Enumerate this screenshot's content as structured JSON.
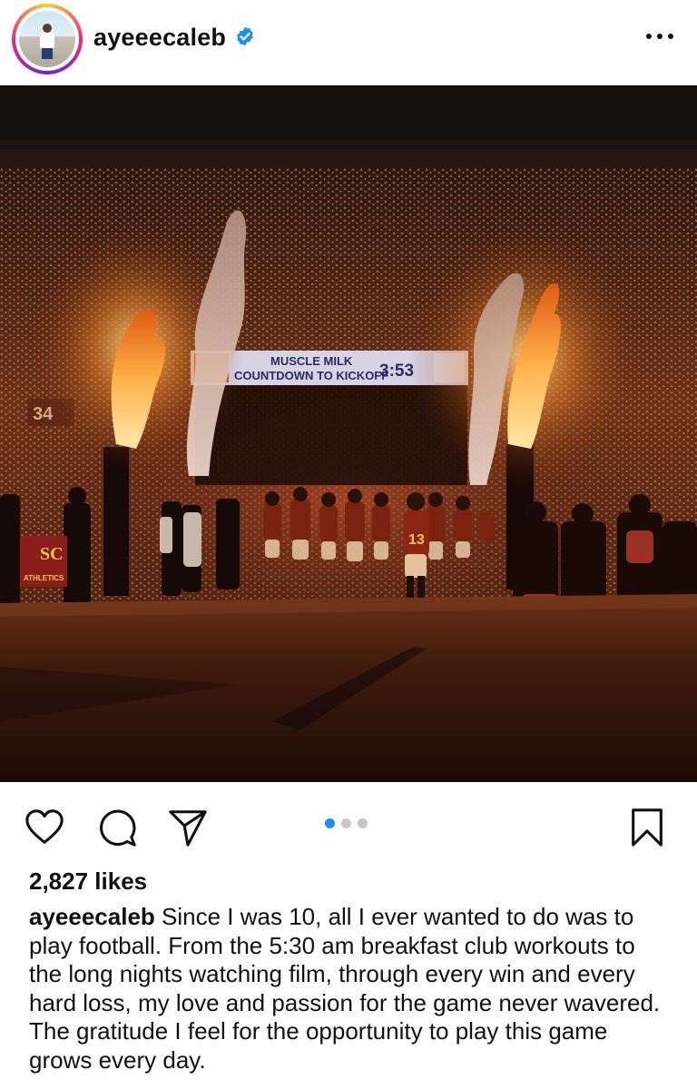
{
  "post": {
    "username": "ayeeecaleb",
    "verified": true,
    "likes": "2,827 likes",
    "caption_user": "ayeeecaleb",
    "caption_text": "Since I was 10, all I ever wanted to do was to play football.  From the 5:30 am breakfast club workouts to the long nights watching film, through every win and every hard loss, my love and passion for the game never wavered. The gratitude I feel for the opportunity to play this game grows every day.",
    "carousel": {
      "total": 3,
      "current": 1
    }
  },
  "photo": {
    "scoreboard_line1": "MUSCLE MILK",
    "scoreboard_line2": "COUNTDOWN TO KICKOFF",
    "scoreboard_time": "3:53",
    "banner_text": "SC",
    "banner_subtext": "ATHLETICS",
    "sign_number": "34"
  },
  "icons": {
    "like": "heart-icon",
    "comment": "comment-icon",
    "share": "send-icon",
    "save": "bookmark-icon",
    "more": "more-options-icon",
    "verified": "verified-badge-icon"
  },
  "colors": {
    "verified_blue": "#1d8ff0",
    "active_dot": "#1d8ff0",
    "inactive_dot": "#c7c7c7"
  }
}
